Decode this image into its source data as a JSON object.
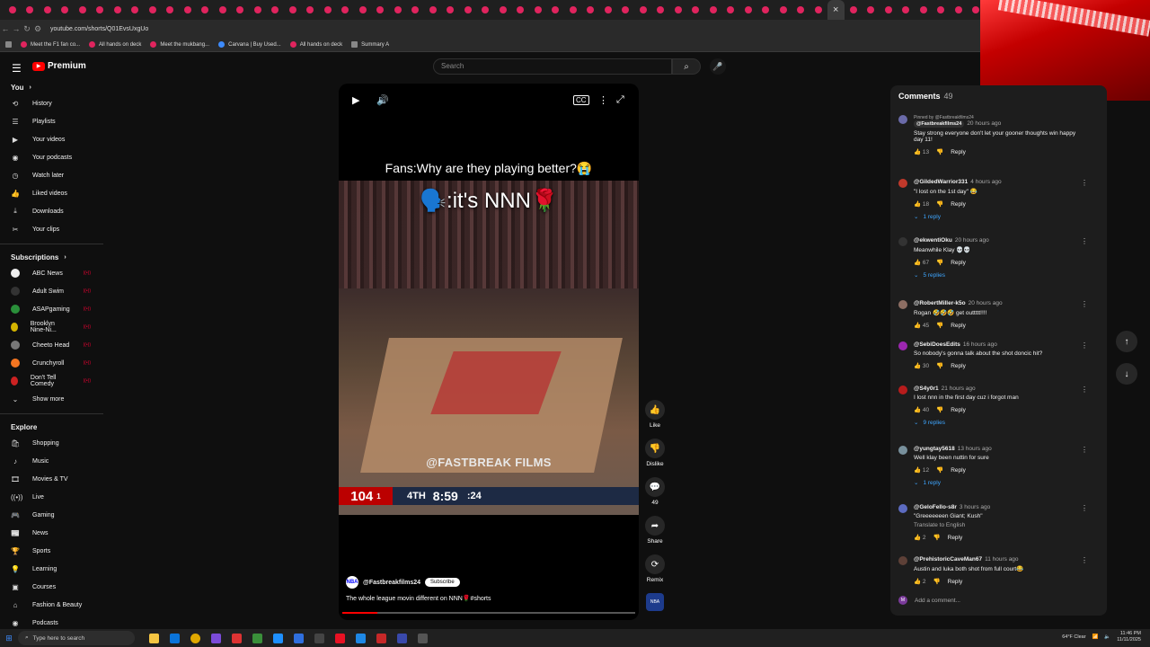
{
  "browser": {
    "url": "youtube.com/shorts/Q01EvsUxgUo",
    "bookmarks": [
      "Meet the F1 fan co...",
      "All hands on deck",
      "Meet the mukbang...",
      "Carvana | Buy Used...",
      "All hands on deck",
      "Summary A"
    ]
  },
  "header": {
    "logo_text": "Premium",
    "search_placeholder": "Search"
  },
  "sidebar": {
    "you_label": "You",
    "you_items": [
      {
        "label": "History",
        "icon": "history-icon"
      },
      {
        "label": "Playlists",
        "icon": "playlist-icon"
      },
      {
        "label": "Your videos",
        "icon": "video-icon"
      },
      {
        "label": "Your podcasts",
        "icon": "podcast-icon"
      },
      {
        "label": "Watch later",
        "icon": "clock-icon"
      },
      {
        "label": "Liked videos",
        "icon": "like-icon"
      },
      {
        "label": "Downloads",
        "icon": "download-icon"
      },
      {
        "label": "Your clips",
        "icon": "scissors-icon"
      }
    ],
    "subscriptions_label": "Subscriptions",
    "subscriptions": [
      {
        "label": "ABC News",
        "color": "#eeeeee"
      },
      {
        "label": "Adult Swim",
        "color": "#333333"
      },
      {
        "label": "ASAPgaming",
        "color": "#2a8f3a"
      },
      {
        "label": "Brooklyn Nine-Ni...",
        "color": "#d4b400"
      },
      {
        "label": "Cheeto Head",
        "color": "#777777"
      },
      {
        "label": "Crunchyroll",
        "color": "#f47521"
      },
      {
        "label": "Don't Tell Comedy",
        "color": "#cc2222"
      }
    ],
    "show_more": "Show more",
    "explore_label": "Explore",
    "explore_items": [
      {
        "label": "Shopping",
        "icon": "bag-icon"
      },
      {
        "label": "Music",
        "icon": "music-icon"
      },
      {
        "label": "Movies & TV",
        "icon": "film-icon"
      },
      {
        "label": "Live",
        "icon": "live-icon"
      },
      {
        "label": "Gaming",
        "icon": "gamepad-icon"
      },
      {
        "label": "News",
        "icon": "news-icon"
      },
      {
        "label": "Sports",
        "icon": "trophy-icon"
      },
      {
        "label": "Learning",
        "icon": "bulb-icon"
      },
      {
        "label": "Courses",
        "icon": "courses-icon"
      },
      {
        "label": "Fashion & Beauty",
        "icon": "hanger-icon"
      },
      {
        "label": "Podcasts",
        "icon": "podcast-icon"
      }
    ]
  },
  "player": {
    "caption_top": "Fans:Why are they playing better?😭",
    "caption_main": "🗣️:it's NNN🌹",
    "watermark": "@FASTBREAK FILMS",
    "score": "104",
    "score_flag": "1",
    "quarter": "4TH",
    "game_clock": "8:59",
    "shot_clock": ":24",
    "channel": "@Fastbreakfilms24",
    "subscribe_label": "Subscribe",
    "video_title": "The whole league movin different on NNN🌹#shorts",
    "progress_fraction": 0.12
  },
  "actions": {
    "like": "Like",
    "dislike": "Dislike",
    "comments_count": "49",
    "share": "Share",
    "remix": "Remix"
  },
  "comments": {
    "title": "Comments",
    "count": "49",
    "add_placeholder": "Add a comment...",
    "items": [
      {
        "pinned": "Pinned by @Fastbreakfilms24",
        "author": "@Fastbreakfilms24",
        "time": "20 hours ago",
        "text": "Stay strong everyone don't let your gooner thoughts win happy day 11!",
        "likes": "13",
        "reply_label": "Reply",
        "replies": "",
        "avatar_color": "#6a6aa8"
      },
      {
        "pinned": "",
        "author": "@GildedWarrior331",
        "time": "4 hours ago",
        "text": "\"I lost on the 1st day\" 😂",
        "likes": "18",
        "reply_label": "Reply",
        "replies": "1 reply",
        "avatar_color": "#c0392b"
      },
      {
        "pinned": "",
        "author": "@ekwentiOku",
        "time": "20 hours ago",
        "text": "Meanwhile Klay 💀💀",
        "likes": "67",
        "reply_label": "Reply",
        "replies": "5 replies",
        "avatar_color": "#333333"
      },
      {
        "pinned": "",
        "author": "@RobertMiller-k5o",
        "time": "20 hours ago",
        "text": "Rogan 🤣🤣🤣 get outtttt!!!!",
        "likes": "45",
        "reply_label": "Reply",
        "replies": "",
        "avatar_color": "#8d6e63"
      },
      {
        "pinned": "",
        "author": "@SebiDoesEdits",
        "time": "16 hours ago",
        "text": "So nobody's gonna talk about the shot doncic hit?",
        "likes": "30",
        "reply_label": "Reply",
        "replies": "",
        "avatar_color": "#9c27b0"
      },
      {
        "pinned": "",
        "author": "@S4y0r1",
        "time": "21 hours ago",
        "text": "I lost nnn in the first day cuz i forgot man",
        "likes": "40",
        "reply_label": "Reply",
        "replies": "9 replies",
        "avatar_color": "#b71c1c"
      },
      {
        "pinned": "",
        "author": "@yungtay5618",
        "time": "13 hours ago",
        "text": "Well klay been nuttin for sure",
        "likes": "12",
        "reply_label": "Reply",
        "replies": "1 reply",
        "avatar_color": "#78909c"
      },
      {
        "pinned": "",
        "author": "@GeloFello-s8r",
        "time": "3 hours ago",
        "text": "\"Greeeeeeen Giant; Kush\"",
        "extra": "Translate to English",
        "likes": "2",
        "reply_label": "Reply",
        "replies": "",
        "avatar_color": "#5c6bc0"
      },
      {
        "pinned": "",
        "author": "@PrehistoricCaveMan67",
        "time": "11 hours ago",
        "text": "Austin and luka both shot from full court😂",
        "likes": "2",
        "reply_label": "Reply",
        "replies": "",
        "avatar_color": "#5d4037"
      }
    ]
  },
  "taskbar": {
    "search_placeholder": "Type here to search",
    "weather": "64°F Clear",
    "time": "11:46 PM",
    "date": "11/11/2025"
  }
}
